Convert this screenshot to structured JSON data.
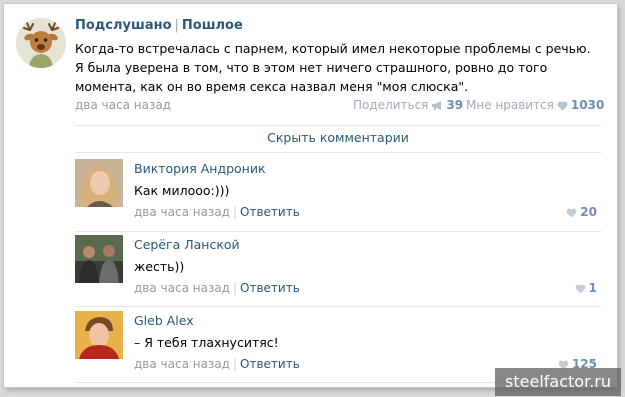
{
  "post": {
    "author": "Подслушано",
    "separator": "|",
    "category": "Пошлое",
    "text": "Когда-то встречалась с парнем, который имел некоторые проблемы с речью. Я была уверена в том, что в этом нет ничего страшного, ровно до того момента, как он во время секса назвал меня \"моя слюска\".",
    "time": "два часа назад",
    "share_label": "Поделиться",
    "share_count": "39",
    "like_label": "Мне нравится",
    "like_count": "1030"
  },
  "hide_comments_label": "Скрыть комментарии",
  "comments": [
    {
      "name": "Виктория Андроник",
      "text": "Как милооо:)))",
      "time": "два часа назад",
      "reply_label": "Ответить",
      "likes": "20"
    },
    {
      "name": "Серёга Ланской",
      "text": "жесть))",
      "time": "два часа назад",
      "reply_label": "Ответить",
      "likes": "1"
    },
    {
      "name": "Gleb Alex",
      "text": "– Я тебя тлахнуситяс!",
      "time": "два часа назад",
      "reply_label": "Ответить",
      "likes": "125"
    }
  ],
  "watermark": "steelfactor.ru",
  "colors": {
    "link": "#2b587a",
    "muted": "#999999",
    "count": "#6f8fb2",
    "icon": "#b6c2cf"
  }
}
